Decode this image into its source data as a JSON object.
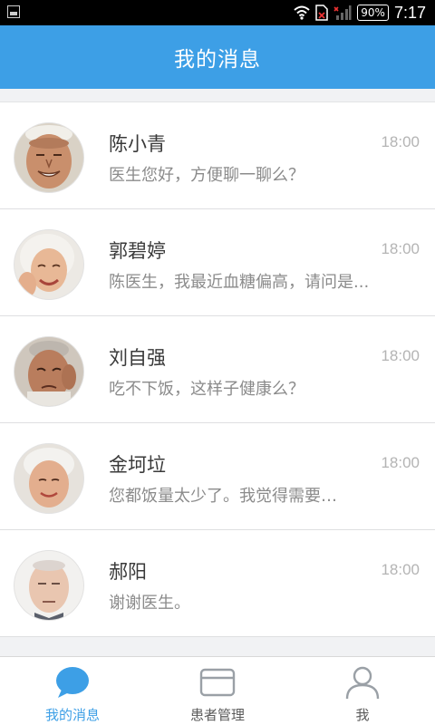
{
  "status_bar": {
    "battery": "90%",
    "time": "7:17"
  },
  "header": {
    "title": "我的消息"
  },
  "messages": [
    {
      "name": "陈小青",
      "time": "18:00",
      "preview": "医生您好，方便聊一聊么？"
    },
    {
      "name": "郭碧婷",
      "time": "18:00",
      "preview": "陈医生，我最近血糖偏高，请问是..."
    },
    {
      "name": "刘自强",
      "time": "18:00",
      "preview": "吃不下饭，这样子健康么？"
    },
    {
      "name": "金坷垃",
      "time": "18:00",
      "preview": "您都饭量太少了。我觉得需要…"
    },
    {
      "name": "郝阳",
      "time": "18:00",
      "preview": "谢谢医生。"
    }
  ],
  "tab_bar": {
    "tabs": [
      {
        "label": "我的消息",
        "icon": "chat-bubble-icon",
        "active": true
      },
      {
        "label": "患者管理",
        "icon": "card-icon",
        "active": false
      },
      {
        "label": "我",
        "icon": "person-icon",
        "active": false
      }
    ],
    "active_color": "#3d9fe6",
    "inactive_color": "#9aa0a6"
  }
}
